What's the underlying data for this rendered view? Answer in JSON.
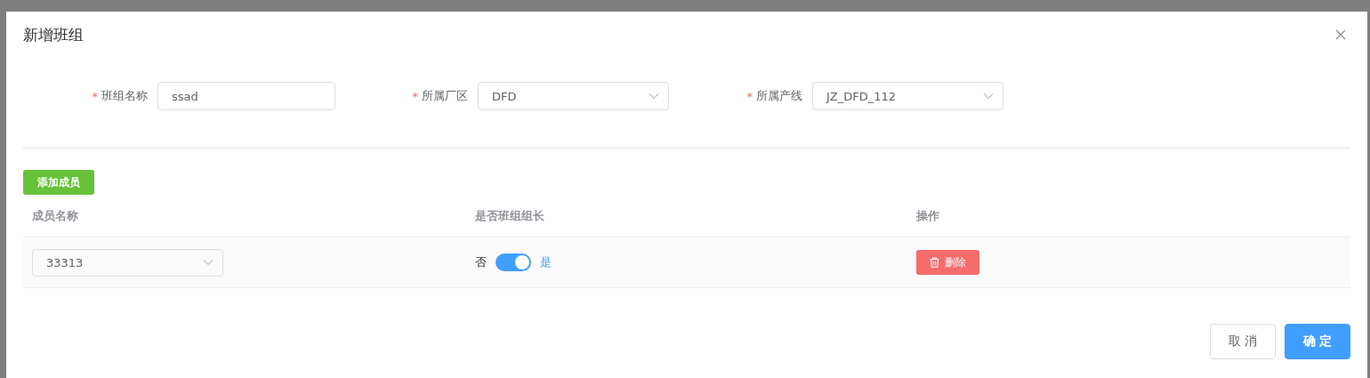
{
  "dialog": {
    "title": "新增班组",
    "fields": [
      {
        "label": "班组名称",
        "required_mark": "*",
        "kind": "input",
        "value": "ssad"
      },
      {
        "label": "所属厂区",
        "required_mark": "*",
        "kind": "select",
        "value": "DFD"
      },
      {
        "label": "所属产线",
        "required_mark": "*",
        "kind": "select",
        "value": "JZ_DFD_112"
      }
    ],
    "add_button": "添加成员",
    "table": {
      "columns": [
        "成员名称",
        "是否班组组长",
        "操作"
      ],
      "rows": [
        {
          "member": "33313",
          "leader_off_label": "否",
          "leader_on_label": "是",
          "leader": true,
          "delete_button": "删除"
        }
      ]
    },
    "buttons": [
      {
        "label": "取 消",
        "kind": "default"
      },
      {
        "label": "确 定",
        "kind": "primary"
      }
    ]
  }
}
